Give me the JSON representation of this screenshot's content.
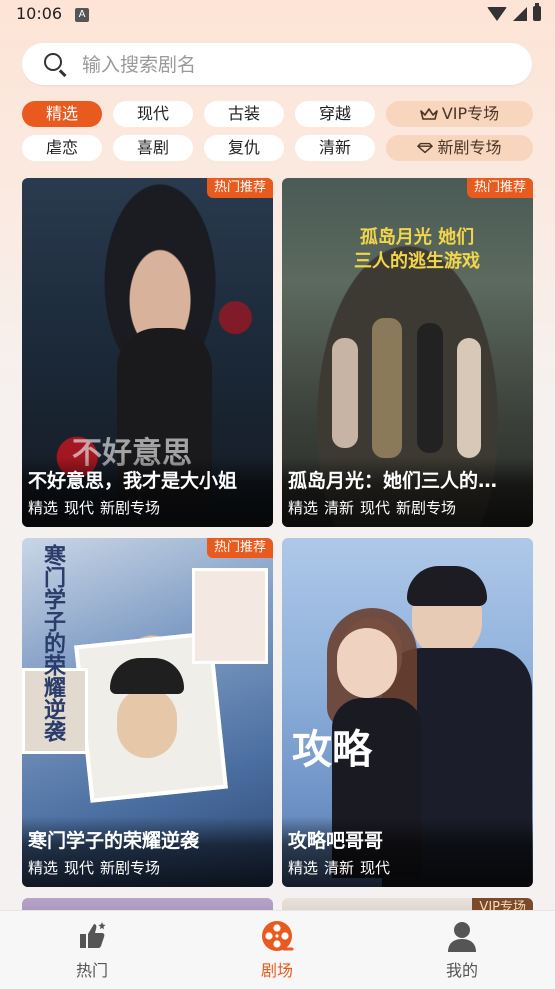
{
  "status_bar": {
    "time": "10:06",
    "app_icon_letter": "A"
  },
  "search": {
    "placeholder": "输入搜索剧名"
  },
  "chips": [
    {
      "label": "精选",
      "active": true
    },
    {
      "label": "现代"
    },
    {
      "label": "古装"
    },
    {
      "label": "穿越"
    },
    {
      "label": "VIP专场",
      "icon": "crown-icon"
    },
    {
      "label": "虐恋"
    },
    {
      "label": "喜剧"
    },
    {
      "label": "复仇"
    },
    {
      "label": "清新"
    },
    {
      "label": "新剧专场",
      "icon": "diamond-icon"
    }
  ],
  "cards": [
    {
      "title": "不好意思，我才是大小姐",
      "tags": [
        "精选",
        "现代",
        "新剧专场"
      ],
      "badge": "热门推荐",
      "poster_text": "不好意思"
    },
    {
      "title": "孤岛月光：她们三人的…",
      "tags": [
        "精选",
        "清新",
        "现代",
        "新剧专场"
      ],
      "badge": "热门推荐",
      "poster_text": "孤岛月光 她们三人的逃生游戏"
    },
    {
      "title": "寒门学子的荣耀逆袭",
      "tags": [
        "精选",
        "现代",
        "新剧专场"
      ],
      "badge": "热门推荐",
      "poster_text": "寒门学子的荣耀逆袭"
    },
    {
      "title": "攻略吧哥哥",
      "tags": [
        "精选",
        "清新",
        "现代"
      ],
      "badge": "",
      "poster_text": "攻略"
    }
  ],
  "partial_badge": "VIP专场",
  "bottom_nav": [
    {
      "label": "热门",
      "icon": "thumbs-up-icon"
    },
    {
      "label": "剧场",
      "icon": "film-reel-icon",
      "active": true
    },
    {
      "label": "我的",
      "icon": "person-icon"
    }
  ],
  "colors": {
    "accent": "#e85a1e",
    "vip_chip": "#f7d6bd"
  }
}
